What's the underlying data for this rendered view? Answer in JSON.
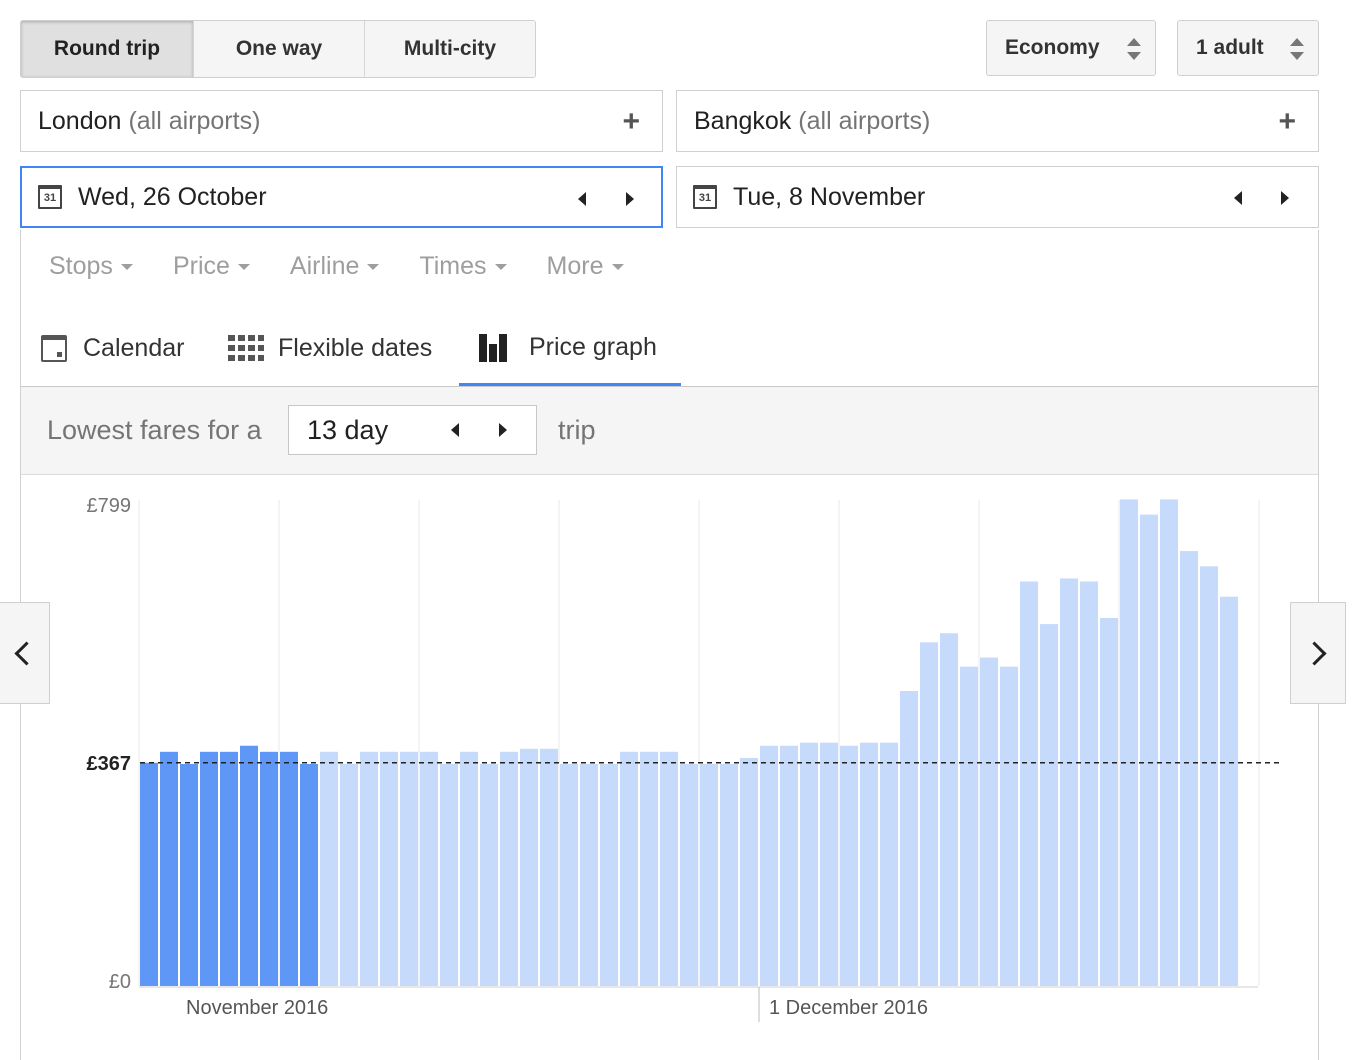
{
  "trip_types": [
    {
      "label": "Round trip",
      "active": true
    },
    {
      "label": "One way",
      "active": false
    },
    {
      "label": "Multi-city",
      "active": false
    }
  ],
  "cabin": {
    "value": "Economy"
  },
  "passengers": {
    "value": "1 adult"
  },
  "origin": {
    "city": "London",
    "hint": "(all airports)"
  },
  "destination": {
    "city": "Bangkok",
    "hint": "(all airports)"
  },
  "depart_date": {
    "icon_day": "31",
    "value": "Wed, 26 October"
  },
  "return_date": {
    "icon_day": "31",
    "value": "Tue, 8 November"
  },
  "filters": [
    "Stops",
    "Price",
    "Airline",
    "Times",
    "More"
  ],
  "view_tabs": [
    {
      "label": "Calendar",
      "icon": "calendar-icon",
      "active": false
    },
    {
      "label": "Flexible dates",
      "icon": "grid-icon",
      "active": false
    },
    {
      "label": "Price graph",
      "icon": "bar-chart-icon",
      "active": true
    }
  ],
  "trip_length": {
    "prefix": "Lowest fares for a",
    "value": "13 day",
    "suffix": "trip"
  },
  "colors": {
    "selected_bar": "#5e97f6",
    "bar": "#c6dafc",
    "accent": "#4285f4"
  },
  "chart_data": {
    "type": "bar",
    "yticks": [
      "£799",
      "£367",
      "£0"
    ],
    "ylim": [
      0,
      799
    ],
    "reference_line": 367,
    "x_labels": [
      "November 2016",
      "1 December 2016"
    ],
    "selected_count": 9,
    "values": [
      367,
      385,
      365,
      385,
      385,
      395,
      385,
      385,
      365,
      385,
      365,
      385,
      385,
      385,
      385,
      365,
      385,
      365,
      385,
      390,
      390,
      365,
      365,
      365,
      385,
      385,
      385,
      365,
      365,
      365,
      375,
      395,
      395,
      400,
      400,
      395,
      400,
      400,
      485,
      565,
      580,
      525,
      540,
      525,
      665,
      595,
      670,
      665,
      605,
      800,
      775,
      800,
      715,
      690,
      640
    ]
  }
}
